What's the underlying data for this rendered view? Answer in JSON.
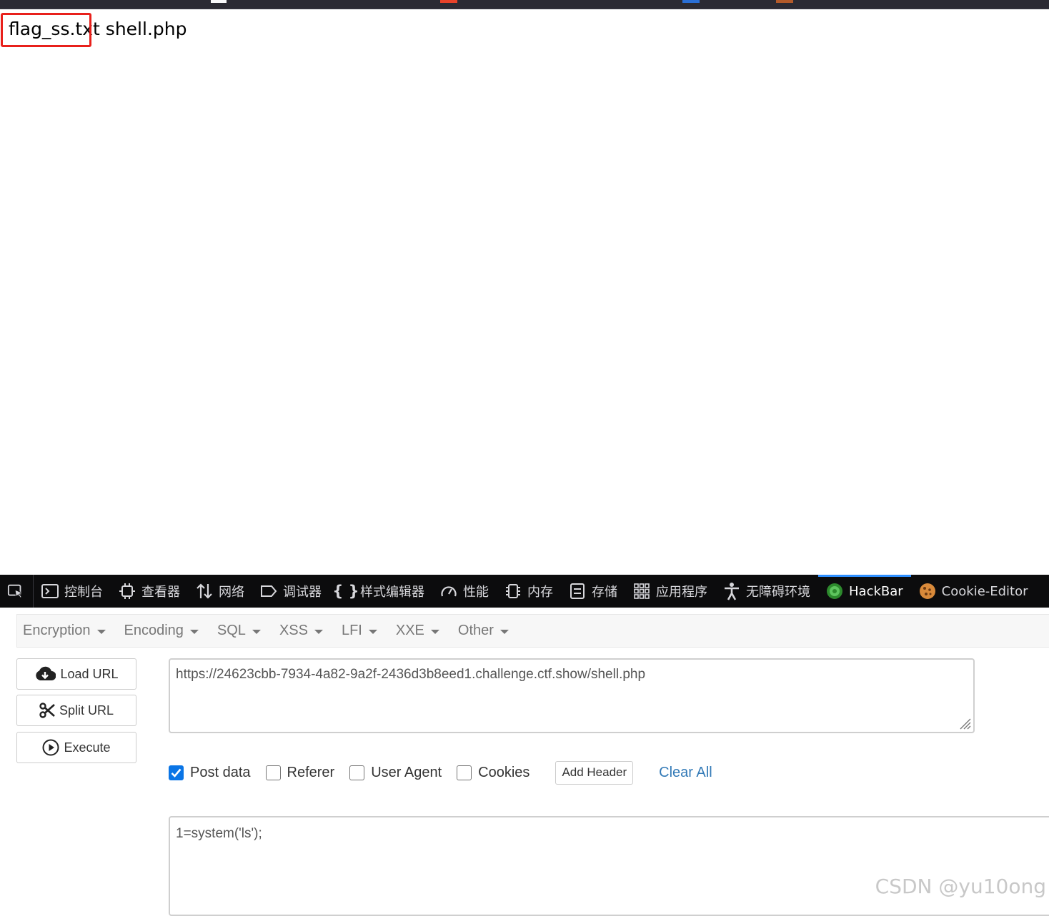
{
  "page": {
    "output_file1": "flag_ss.txt",
    "output_file2": "shell.php"
  },
  "devtools": {
    "tabs": [
      {
        "label": "控制台",
        "icon": "console-icon"
      },
      {
        "label": "查看器",
        "icon": "inspector-icon"
      },
      {
        "label": "网络",
        "icon": "network-icon"
      },
      {
        "label": "调试器",
        "icon": "debugger-icon"
      },
      {
        "label": "样式编辑器",
        "icon": "style-editor-icon"
      },
      {
        "label": "性能",
        "icon": "performance-icon"
      },
      {
        "label": "内存",
        "icon": "memory-icon"
      },
      {
        "label": "存储",
        "icon": "storage-icon"
      },
      {
        "label": "应用程序",
        "icon": "application-icon"
      },
      {
        "label": "无障碍环境",
        "icon": "accessibility-icon"
      },
      {
        "label": "HackBar",
        "icon": "hackbar-icon",
        "active": true
      },
      {
        "label": "Cookie-Editor",
        "icon": "cookie-icon"
      }
    ]
  },
  "hackbar": {
    "menus": [
      "Encryption",
      "Encoding",
      "SQL",
      "XSS",
      "LFI",
      "XXE",
      "Other"
    ],
    "buttons": {
      "load_url": "Load URL",
      "split_url": "Split URL",
      "execute": "Execute"
    },
    "url": "https://24623cbb-7934-4a82-9a2f-2436d3b8eed1.challenge.ctf.show/shell.php",
    "options": {
      "post_data": {
        "label": "Post data",
        "checked": true
      },
      "referer": {
        "label": "Referer",
        "checked": false
      },
      "user_agent": {
        "label": "User Agent",
        "checked": false
      },
      "cookies": {
        "label": "Cookies",
        "checked": false
      }
    },
    "add_header": "Add Header",
    "clear_all": "Clear All",
    "post_body": "1=system('ls');"
  },
  "watermark": "CSDN @yu10ong",
  "colors": {
    "highlight_border": "#e8201b",
    "devtools_bg": "#0c0c0d",
    "active_tab_accent": "#2e8fff",
    "checkbox_checked": "#0a75e6",
    "link": "#337ab7"
  }
}
